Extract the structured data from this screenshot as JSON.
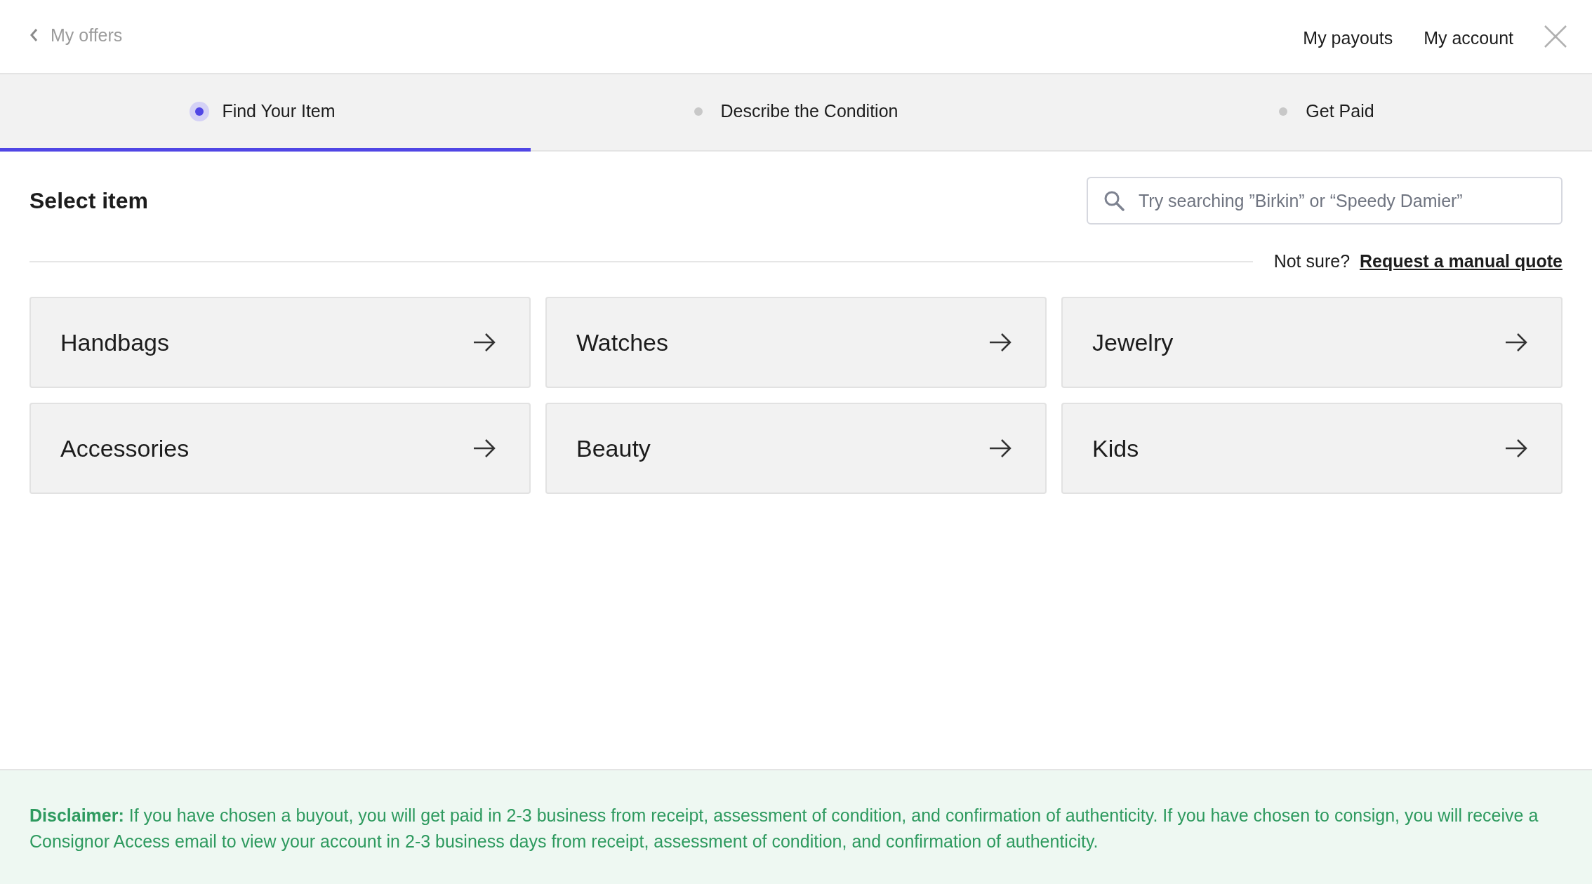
{
  "header": {
    "back_link": "My offers",
    "links": [
      "My payouts",
      "My account"
    ]
  },
  "steps": [
    {
      "label": "Find Your Item",
      "selected": true
    },
    {
      "label": "Describe the Condition",
      "selected": false
    },
    {
      "label": "Get Paid",
      "selected": false
    }
  ],
  "title": "Select item",
  "search": {
    "placeholder": "Try searching ”Birkin” or “Speedy Damier”"
  },
  "manual_quote": {
    "prompt": "Not sure?",
    "link": "Request a manual quote"
  },
  "categories": [
    "Handbags",
    "Watches",
    "Jewelry",
    "Accessories",
    "Beauty",
    "Kids"
  ],
  "disclaimer": "**Disclaimer:** If you have chosen a buyout, you will get paid in 2-3 business from receipt, assessment of condition, and confirmation of authenticity. If you have chosen to consign, you will receive a Consignor Access email to view your account in 2-3 business days from receipt, assessment of condition, and confirmation of authenticity."
}
